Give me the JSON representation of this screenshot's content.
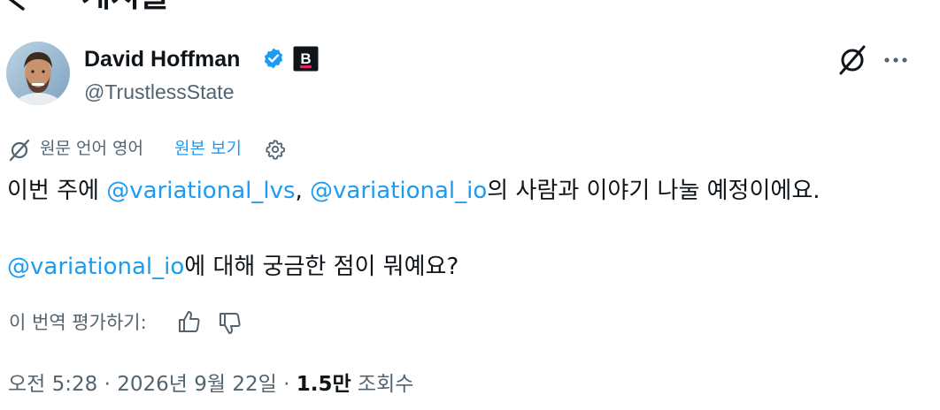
{
  "header": {
    "title": "게시물"
  },
  "author": {
    "name": "David Hoffman",
    "handle": "@TrustlessState",
    "verified_color": "#1d9bf0",
    "affiliation_badge": "B"
  },
  "translation": {
    "label": "원문 언어 영어",
    "show_original": "원본 보기"
  },
  "tweet": {
    "line1_prefix": "이번 주에 ",
    "mention1": "@variational_lvs",
    "sep": ", ",
    "mention2": "@variational_io",
    "line1_suffix": "의 사람과 이야기 나눌 예정이에요.",
    "mention3": "@variational_io",
    "line2_suffix": "에 대해 궁금한 점이 뭐예요?"
  },
  "rate": {
    "label": "이 번역 평가하기:"
  },
  "meta": {
    "time": "오전 5:28",
    "dot": " · ",
    "date": "2026년 9월 22일",
    "views_count": "1.5만",
    "views_label": " 조회수"
  },
  "colors": {
    "accent": "#1d9bf0",
    "secondary_text": "#536471",
    "primary_text": "#0f1419"
  },
  "icons": [
    "back-arrow-icon",
    "verified-badge-icon",
    "affiliation-badge-icon",
    "grok-icon",
    "more-icon",
    "translate-icon",
    "settings-icon",
    "thumbs-up-icon",
    "thumbs-down-icon"
  ]
}
